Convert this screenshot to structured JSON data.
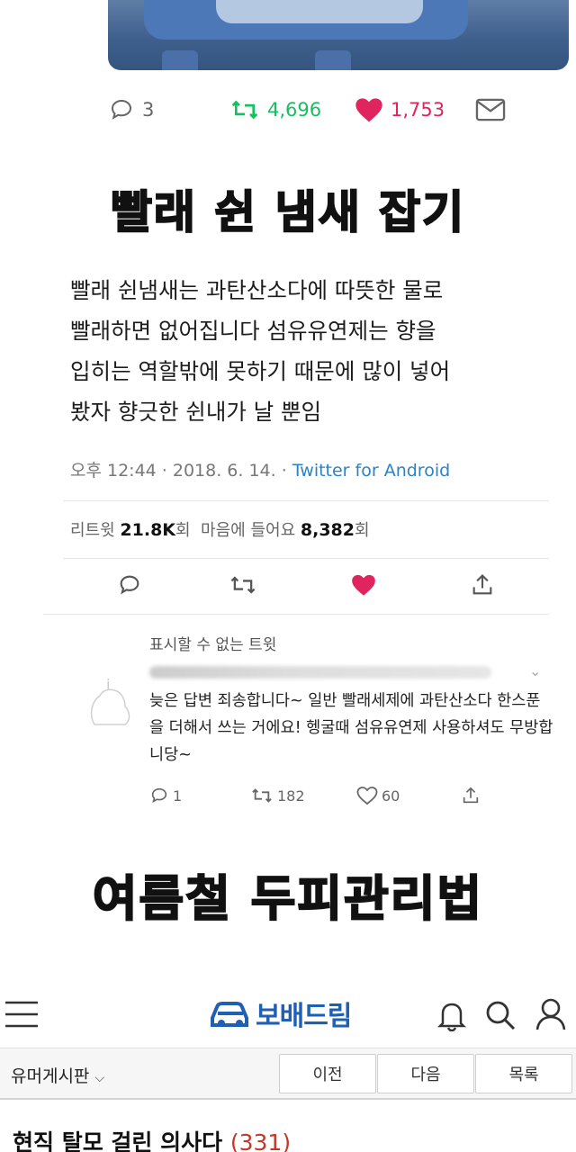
{
  "tweet": {
    "stats_top": {
      "replies": "3",
      "retweets": "4,696",
      "likes": "1,753"
    },
    "body": [
      "빨래 쉰냄새는 과탄산소다에 따뜻한 물로",
      "빨래하면 없어집니다 섬유유연제는 향을",
      "입히는 역할밖에 못하기 때문에 많이 넣어",
      "봤자 향긋한 쉰내가 날 뿐임"
    ],
    "time": "오후 12:44 · 2018. 6. 14. · ",
    "client": "Twitter for Android",
    "retweet_label": "리트윗",
    "retweet_count": "21.8K",
    "retweet_unit": "회",
    "like_label": "마음에 들어요",
    "like_count": "8,382",
    "like_unit": "회"
  },
  "headlines": {
    "first": "빨래 쉰 냄새 잡기",
    "second": "여름철 두피관리법"
  },
  "reply": {
    "hidden_label": "표시할 수 없는 트윗",
    "text": "늦은 답변 죄송합니다~ 일반 빨래세제에 과탄산소다 한스푼을 더해서 쓰는 거에요! 헹굴때 섬유유연제 사용하셔도 무방합니당~",
    "replies": "1",
    "retweets": "182",
    "likes": "60"
  },
  "app": {
    "logo": "보배드림",
    "board": "유머게시판",
    "prev": "이전",
    "next": "다음",
    "list": "목록",
    "post_title": "현직 탈모 걸린 의사다",
    "post_count": "(331)"
  },
  "colors": {
    "like_red": "#e0245e",
    "retweet_green": "#17bf63",
    "link_blue": "#2b83c6",
    "logo_blue": "#1f5fb4",
    "count_red": "#c0392b"
  }
}
